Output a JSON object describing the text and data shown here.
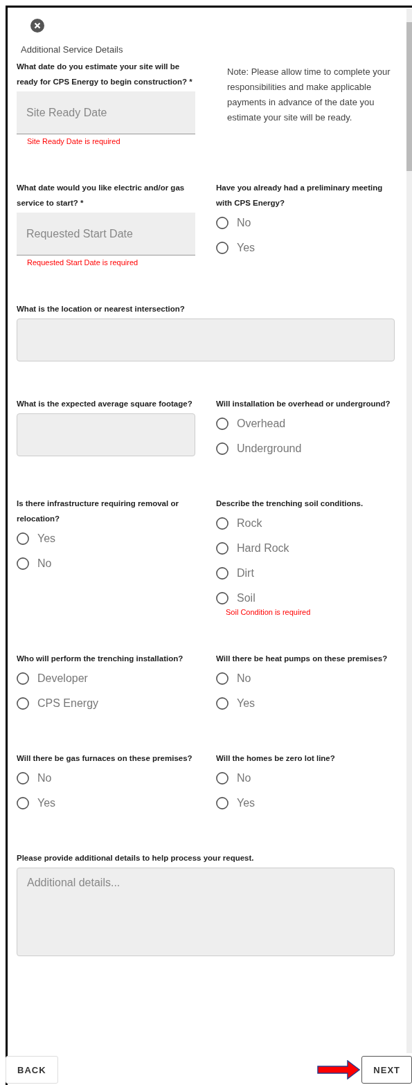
{
  "title": "Additional Service Details",
  "rows": [
    {
      "left": {
        "kind": "date",
        "label": "What date do you estimate your site will be ready for CPS Energy to begin construction? *",
        "placeholder": "Site Ready Date",
        "error": "Site Ready Date is required"
      },
      "right": {
        "kind": "note",
        "text": "Note: Please allow time to complete your responsibilities and make applicable payments in advance of the date you estimate your site will be ready."
      }
    },
    {
      "left": {
        "kind": "date",
        "label": "What date would you like electric and/or gas service to start? *",
        "placeholder": "Requested Start Date",
        "error": "Requested Start Date is required"
      },
      "right": {
        "kind": "radio",
        "label": "Have you already had a preliminary meeting with CPS Energy?",
        "options": [
          {
            "label": "No",
            "selected": false
          },
          {
            "label": "Yes",
            "selected": false
          }
        ]
      }
    },
    {
      "full": {
        "kind": "text",
        "label": "What is the location or nearest intersection?"
      }
    },
    {
      "left": {
        "kind": "text",
        "label": "What is the expected average square footage?"
      },
      "right": {
        "kind": "radio",
        "label": "Will installation be overhead or underground?",
        "options": [
          {
            "label": "Overhead",
            "selected": false
          },
          {
            "label": "Underground",
            "selected": false
          }
        ]
      }
    },
    {
      "left": {
        "kind": "radio",
        "label": "Is there infrastructure requiring removal or relocation?",
        "options": [
          {
            "label": "Yes",
            "selected": false
          },
          {
            "label": "No",
            "selected": false
          }
        ]
      },
      "right": {
        "kind": "radio",
        "label": "Describe the trenching soil conditions.",
        "options": [
          {
            "label": "Rock",
            "selected": false
          },
          {
            "label": "Hard Rock",
            "selected": false
          },
          {
            "label": "Dirt",
            "selected": false
          },
          {
            "label": "Soil",
            "selected": false
          }
        ],
        "error": "Soil Condition is required"
      }
    },
    {
      "left": {
        "kind": "radio",
        "label": "Who will perform the trenching installation?",
        "options": [
          {
            "label": "Developer",
            "selected": false
          },
          {
            "label": "CPS Energy",
            "selected": false
          }
        ]
      },
      "right": {
        "kind": "radio",
        "label": "Will there be heat pumps on these premises?",
        "options": [
          {
            "label": "No",
            "selected": false
          },
          {
            "label": "Yes",
            "selected": false
          }
        ]
      }
    },
    {
      "left": {
        "kind": "radio",
        "label": "Will there be gas furnaces on these premises?",
        "options": [
          {
            "label": "No",
            "selected": false
          },
          {
            "label": "Yes",
            "selected": false
          }
        ]
      },
      "right": {
        "kind": "radio",
        "label": "Will the homes be zero lot line?",
        "options": [
          {
            "label": "No",
            "selected": false
          },
          {
            "label": "Yes",
            "selected": false
          }
        ]
      }
    },
    {
      "full": {
        "kind": "textarea",
        "label": "Please provide additional details to help process your request.",
        "placeholder": "Additional details..."
      }
    }
  ],
  "buttons": {
    "back": "BACK",
    "next": "NEXT"
  }
}
